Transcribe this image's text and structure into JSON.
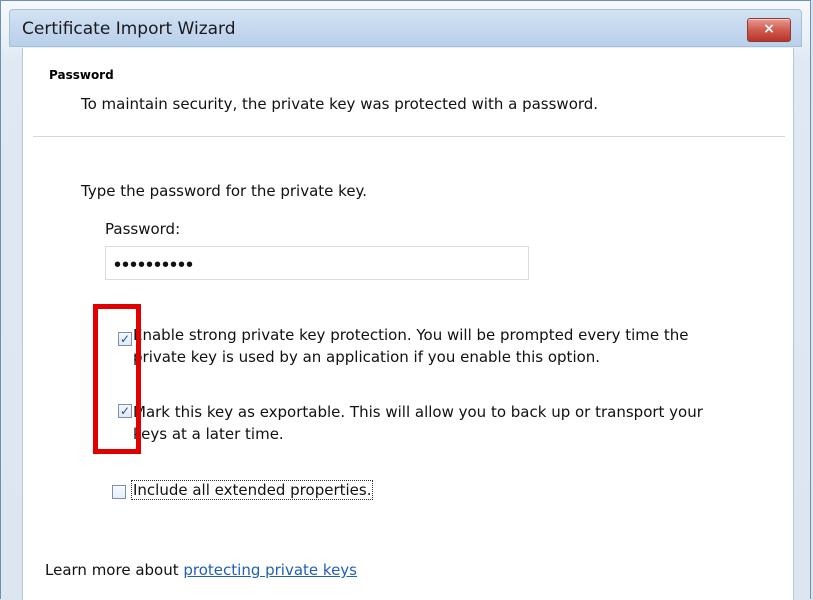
{
  "window": {
    "title": "Certificate Import Wizard",
    "close_label": "×"
  },
  "page": {
    "section_title": "Password",
    "section_description": "To maintain security, the private key was protected with a password.",
    "instruction": "Type the password for the private key.",
    "password_label": "Password:",
    "password_value": "••••••••••"
  },
  "options": {
    "strong_protection": {
      "checked": true,
      "line1": "Enable strong private key protection. You will be prompted every time the",
      "line2": "private key is used by an application if you enable this option."
    },
    "exportable": {
      "checked": true,
      "line1": "Mark this key as exportable. This will allow you to back up or transport your",
      "line2": "keys at a later time."
    },
    "extended_properties": {
      "checked": false,
      "label": "Include all extended properties."
    }
  },
  "footer": {
    "learn_more_prefix": "Learn more about ",
    "learn_more_link": "protecting private keys"
  },
  "colors": {
    "highlight": "#e00000",
    "link": "#1f5fb8"
  }
}
